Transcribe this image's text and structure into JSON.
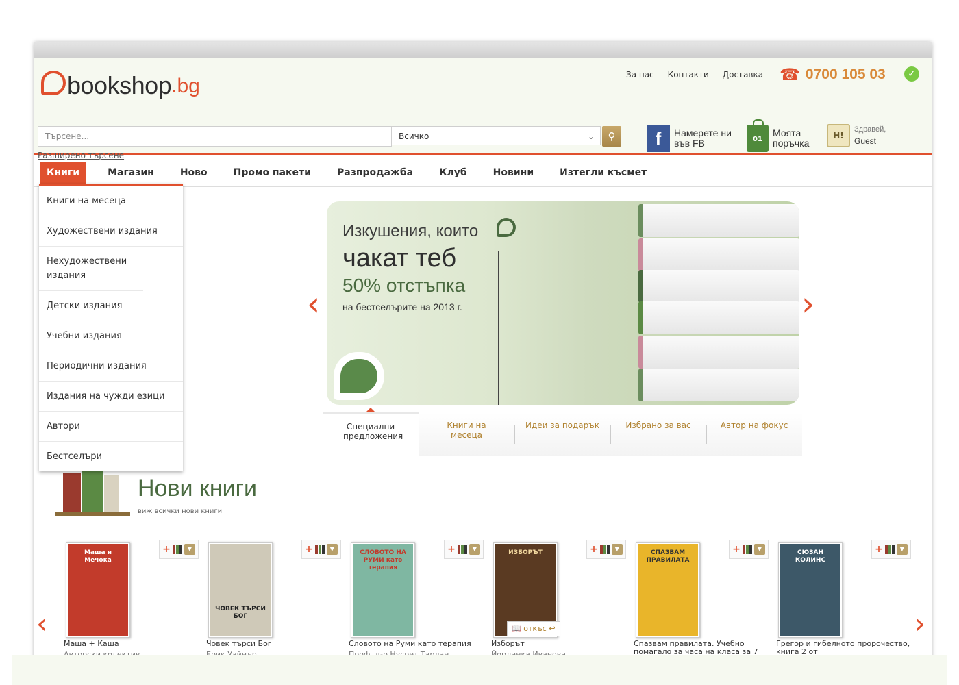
{
  "header": {
    "logo": {
      "name": "bookshop",
      "tld": ".bg"
    },
    "links": [
      "За нас",
      "Контакти",
      "Доставка"
    ],
    "phone": "0700 105 03",
    "search": {
      "placeholder": "Търсене...",
      "category": "Всичко",
      "advanced": "Разширено търсене"
    },
    "facebook": "Намерете ни във FB",
    "order": {
      "count": "01",
      "label": "Моята поръчка"
    },
    "user": {
      "avatar": "H!",
      "greeting": "Здравей,",
      "name": "Guest"
    }
  },
  "nav": {
    "items": [
      "Книги",
      "Магазин",
      "Ново",
      "Промо пакети",
      "Разпродажба",
      "Клуб",
      "Новини",
      "Изтегли късмет"
    ]
  },
  "dropdown": {
    "items": [
      "Книги на месеца",
      "Художествени издания",
      "Нехудожествени издания",
      "Детски издания",
      "Учебни издания",
      "Периодични издания",
      "Издания на чужди езици",
      "Автори",
      "Бестселъри"
    ]
  },
  "banner": {
    "line1": "Изкушения, които",
    "line2": "чакат теб",
    "line3": "50% отстъпка",
    "line4": "на бестселърите на 2013 г."
  },
  "tabs": [
    "Специални предложения",
    "Книги на месеца",
    "Идеи за подарък",
    "Избрано за вас",
    "Автор на фокус"
  ],
  "new_books": {
    "title": "Нови книги",
    "subtitle": "виж всички нови книги",
    "excerpt_label": "откъс",
    "items": [
      {
        "title": "Маша + Каша",
        "author": "Авторски колектив",
        "cover_text": "Маша и Мечока",
        "color": "#c23b2b"
      },
      {
        "title": "Човек търси Бог",
        "author": "Ерик Уайнър",
        "cover_text": "ЧОВЕК ТЪРСИ БОГ",
        "color": "#cfc9b8"
      },
      {
        "title": "Словото на Руми като терапия",
        "author": "Проф. д-р Нусрет Тарлан",
        "cover_text": "СЛОВОТО НА РУМИ като терапия",
        "color": "#7fb7a2"
      },
      {
        "title": "Изборът",
        "author": "Йорданка Иванова",
        "cover_text": "ИЗБОРЪТ",
        "color": "#5a3a22"
      },
      {
        "title": "Спазвам правилата. Учебно помагало за часа на класа за 7",
        "author": "",
        "cover_text": "СПАЗВАМ ПРАВИЛАТА",
        "color": "#e9b52a"
      },
      {
        "title": "Грегор и гибелното пророчество, книга 2 от",
        "author": "",
        "cover_text": "СЮЗАН КОЛИНС",
        "color": "#3d5868"
      }
    ]
  },
  "colors": {
    "accent": "#e0502e",
    "green": "#4a6a40",
    "gold": "#d98a3a"
  }
}
